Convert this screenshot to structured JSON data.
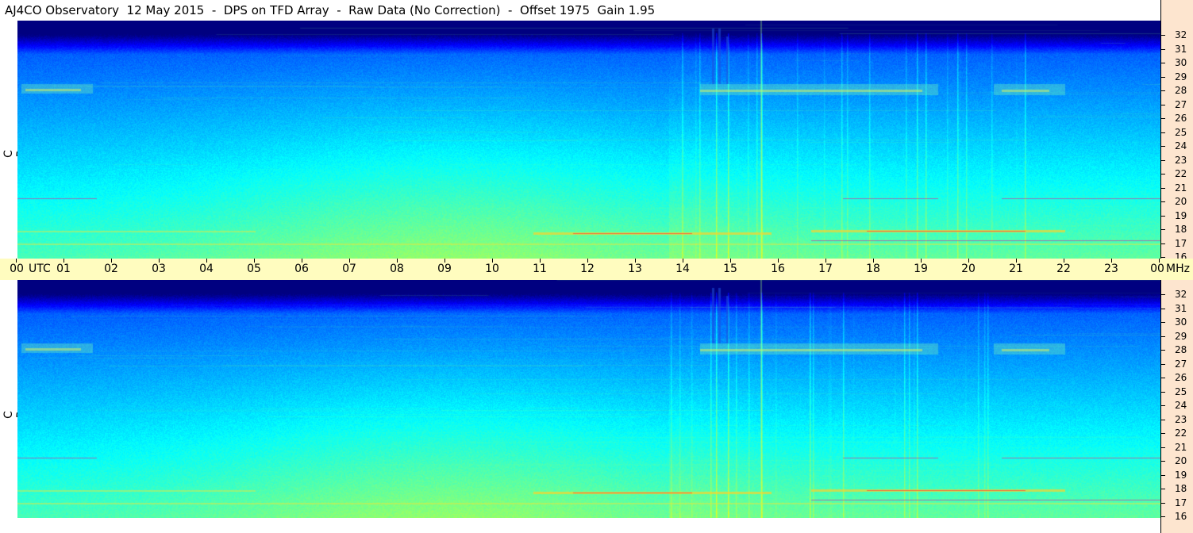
{
  "header": {
    "title": "AJ4CO Observatory  12 May 2015  -  DPS on TFD Array  -  Raw Data (No Correction)  -  Offset 1975  Gain 1.95"
  },
  "panels": {
    "rcp_label": "R C P",
    "lcp_label": "L C P"
  },
  "time_axis": {
    "hours": [
      "00",
      "01",
      "02",
      "03",
      "04",
      "05",
      "06",
      "07",
      "08",
      "09",
      "10",
      "11",
      "12",
      "13",
      "14",
      "15",
      "16",
      "17",
      "18",
      "19",
      "20",
      "21",
      "22",
      "23",
      "00"
    ],
    "utc_label": "UTC",
    "unit_label": "MHz"
  },
  "frequency_axis": {
    "ticks": [
      "32",
      "31",
      "30",
      "29",
      "28",
      "27",
      "26",
      "25",
      "24",
      "23",
      "22",
      "21",
      "20",
      "19",
      "18",
      "17",
      "16"
    ]
  },
  "colors": {
    "time_axis_bg": "#fffcbf",
    "scale_bg": "#fde5cf",
    "colormap": "jet"
  }
}
